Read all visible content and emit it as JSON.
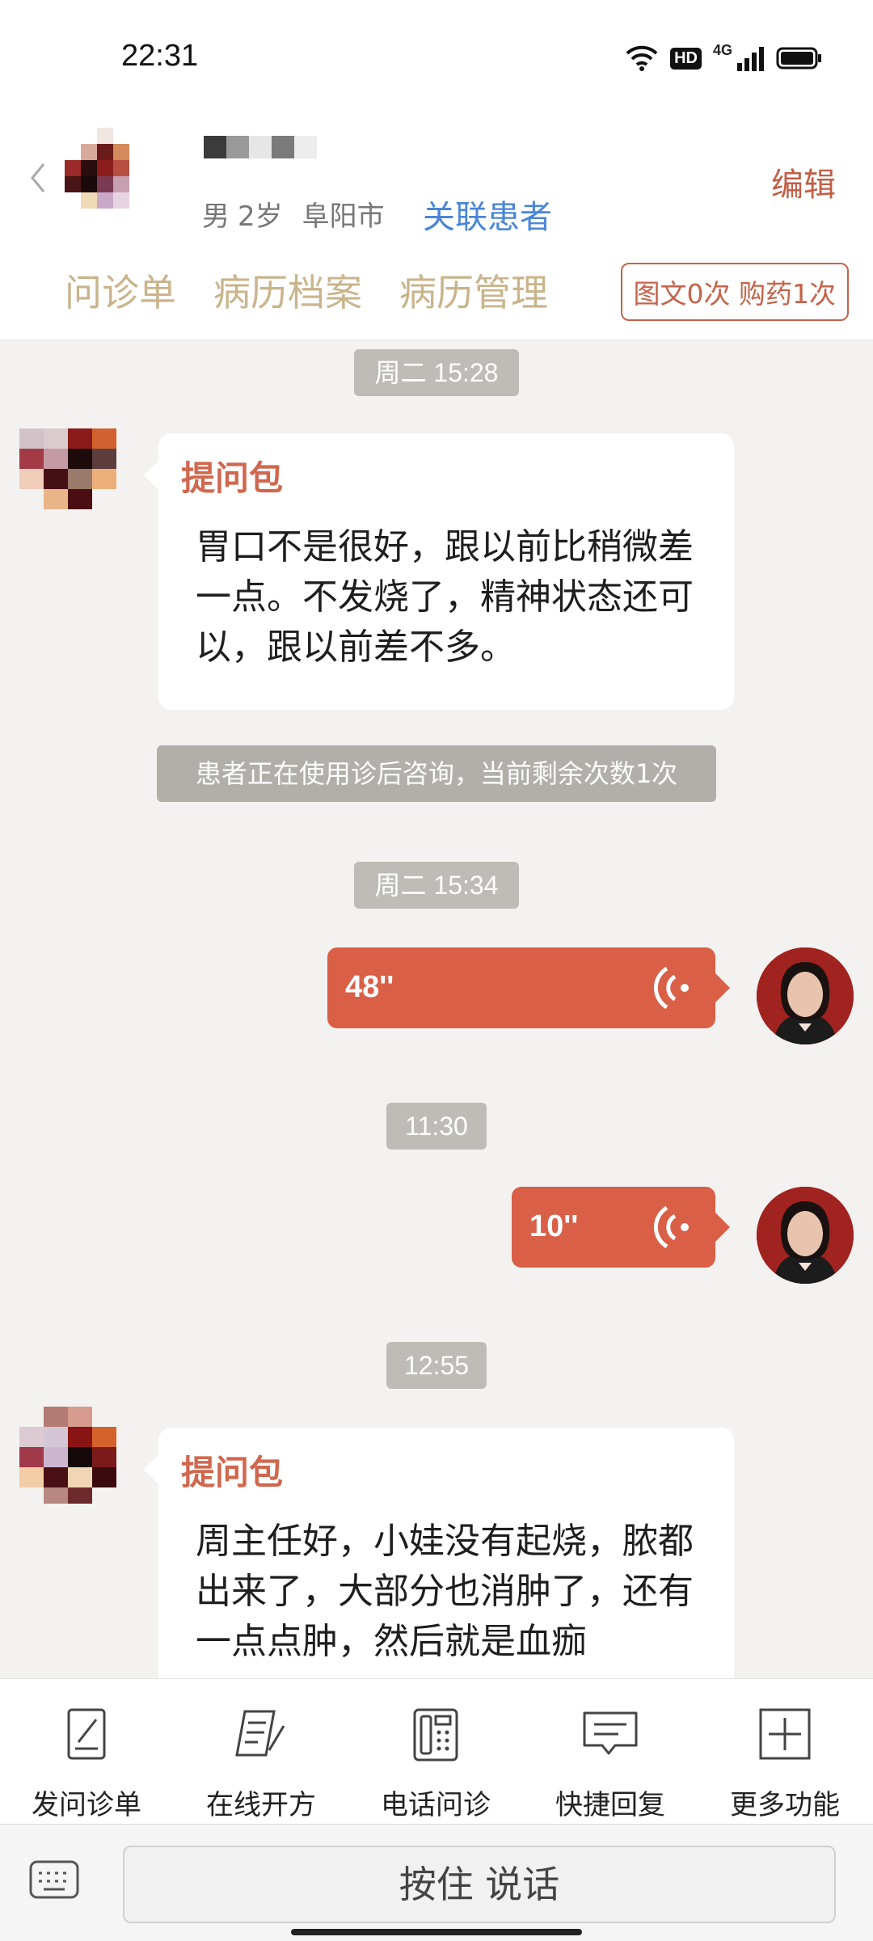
{
  "status_bar": {
    "time": "22:31",
    "network": "4G",
    "hd": "HD"
  },
  "header": {
    "gender": "男",
    "age": "2岁",
    "city": "阜阳市",
    "link_patient": "关联患者",
    "edit": "编辑",
    "tabs": [
      "问诊单",
      "病历档案",
      "病历管理"
    ],
    "counts": "图文0次 购药1次"
  },
  "messages": {
    "time1": "周二 15:28",
    "bubble1": {
      "title": "提问包",
      "text": "胃口不是很好，跟以前比稍微差一点。不发烧了，精神状态还可以，跟以前差不多。"
    },
    "system": "患者正在使用诊后咨询，当前剩余次数1次",
    "time2": "周二 15:34",
    "voice1": "48''",
    "time3": "11:30",
    "voice2": "10''",
    "time4": "12:55",
    "bubble2": {
      "title": "提问包",
      "text": "周主任好，小娃没有起烧，脓都出来了，大部分也消肿了，还有一点点肿，然后就是血痂"
    }
  },
  "toolbar": [
    "发问诊单",
    "在线开方",
    "电话问诊",
    "快捷回复",
    "更多功能"
  ],
  "input": {
    "talk": "按住 说话"
  }
}
